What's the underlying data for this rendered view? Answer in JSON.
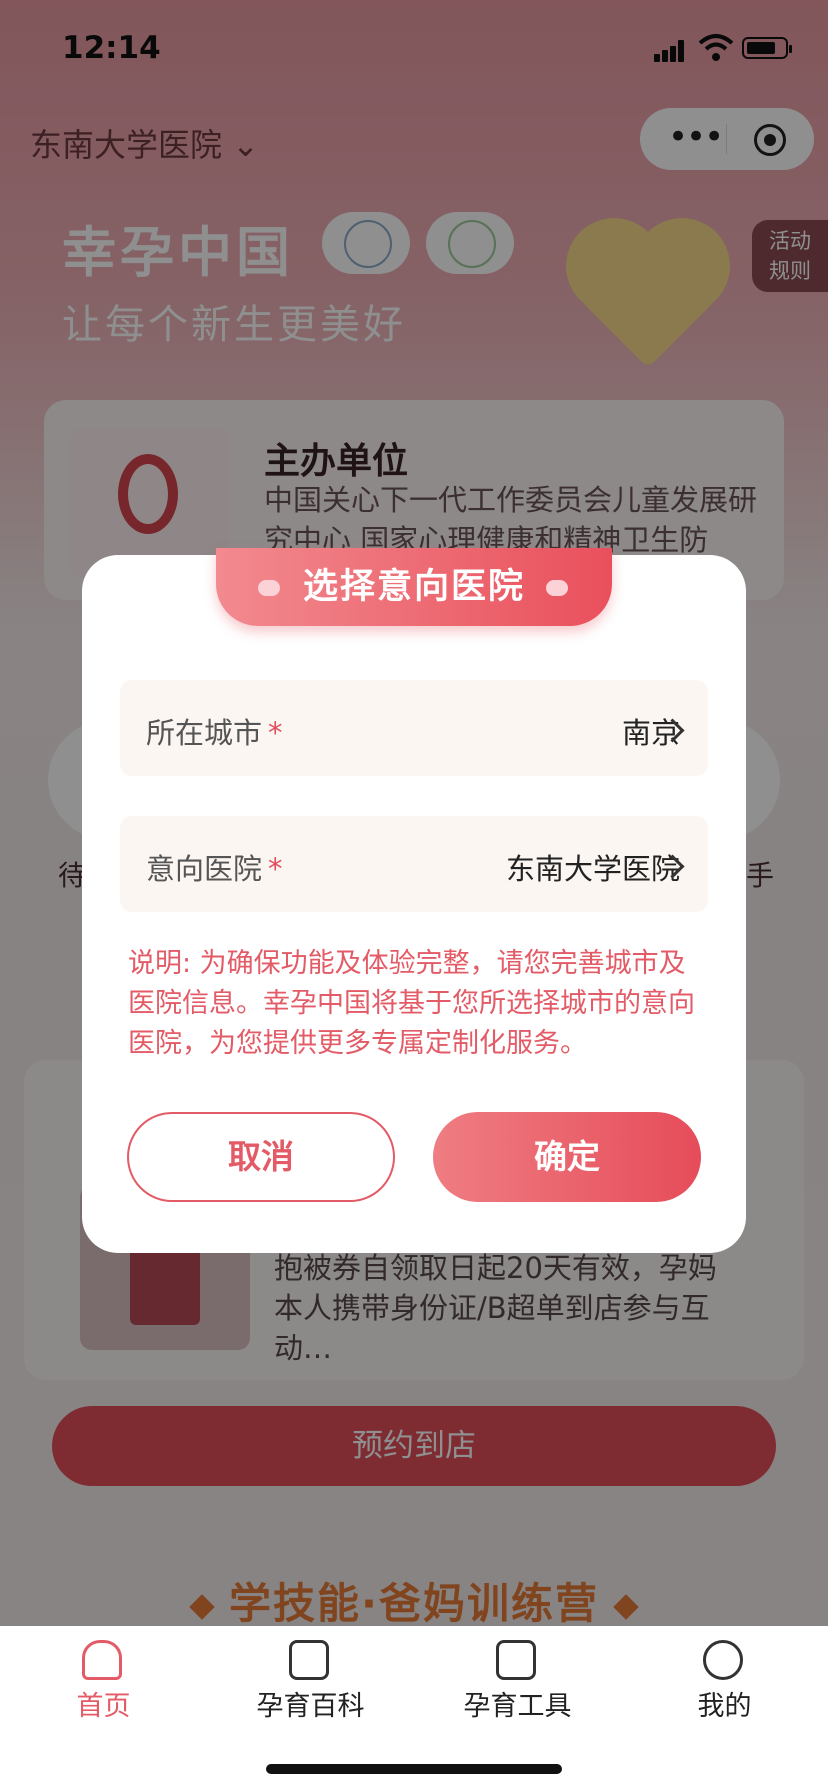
{
  "status_bar": {
    "time": "12:14"
  },
  "header": {
    "hospital_selector": "东南大学医院 ⌄"
  },
  "banner": {
    "title": "幸孕中国",
    "subtitle": "让每个新生更美好",
    "rules_line1": "活动",
    "rules_line2": "规则"
  },
  "organizer": {
    "title": "主办单位",
    "description": "中国关心下一代工作委员会儿童发展研究中心 国家心理健康和精神卫生防"
  },
  "background_labels": {
    "left_char": "待",
    "right_char": "手"
  },
  "gift": {
    "description": "抱被券自领取日起20天有效，孕妈本人携带身份证/B超单到店参与互动…",
    "reserve_button": "预约到店"
  },
  "camp": {
    "title": "学技能·爸妈训练营"
  },
  "dialog": {
    "title": "选择意向医院",
    "city_label": "所在城市",
    "city_value": "南京",
    "hospital_label": "意向医院",
    "hospital_value": "东南大学医院",
    "required_mark": "*",
    "note": "说明: 为确保功能及体验完整，请您完善城市及医院信息。幸孕中国将基于您所选择城市的意向医院，为您提供更多专属定制化服务。",
    "cancel_button": "取消",
    "confirm_button": "确定"
  },
  "tabbar": {
    "items": [
      {
        "label": "首页",
        "icon": "home-icon",
        "active": true
      },
      {
        "label": "孕育百科",
        "icon": "encyclopedia-icon",
        "active": false
      },
      {
        "label": "孕育工具",
        "icon": "toolbox-icon",
        "active": false
      },
      {
        "label": "我的",
        "icon": "profile-icon",
        "active": false
      }
    ]
  },
  "colors": {
    "accent": "#e35b66",
    "banner_bg": "#e89aa3",
    "field_bg": "#fbf6f2"
  }
}
